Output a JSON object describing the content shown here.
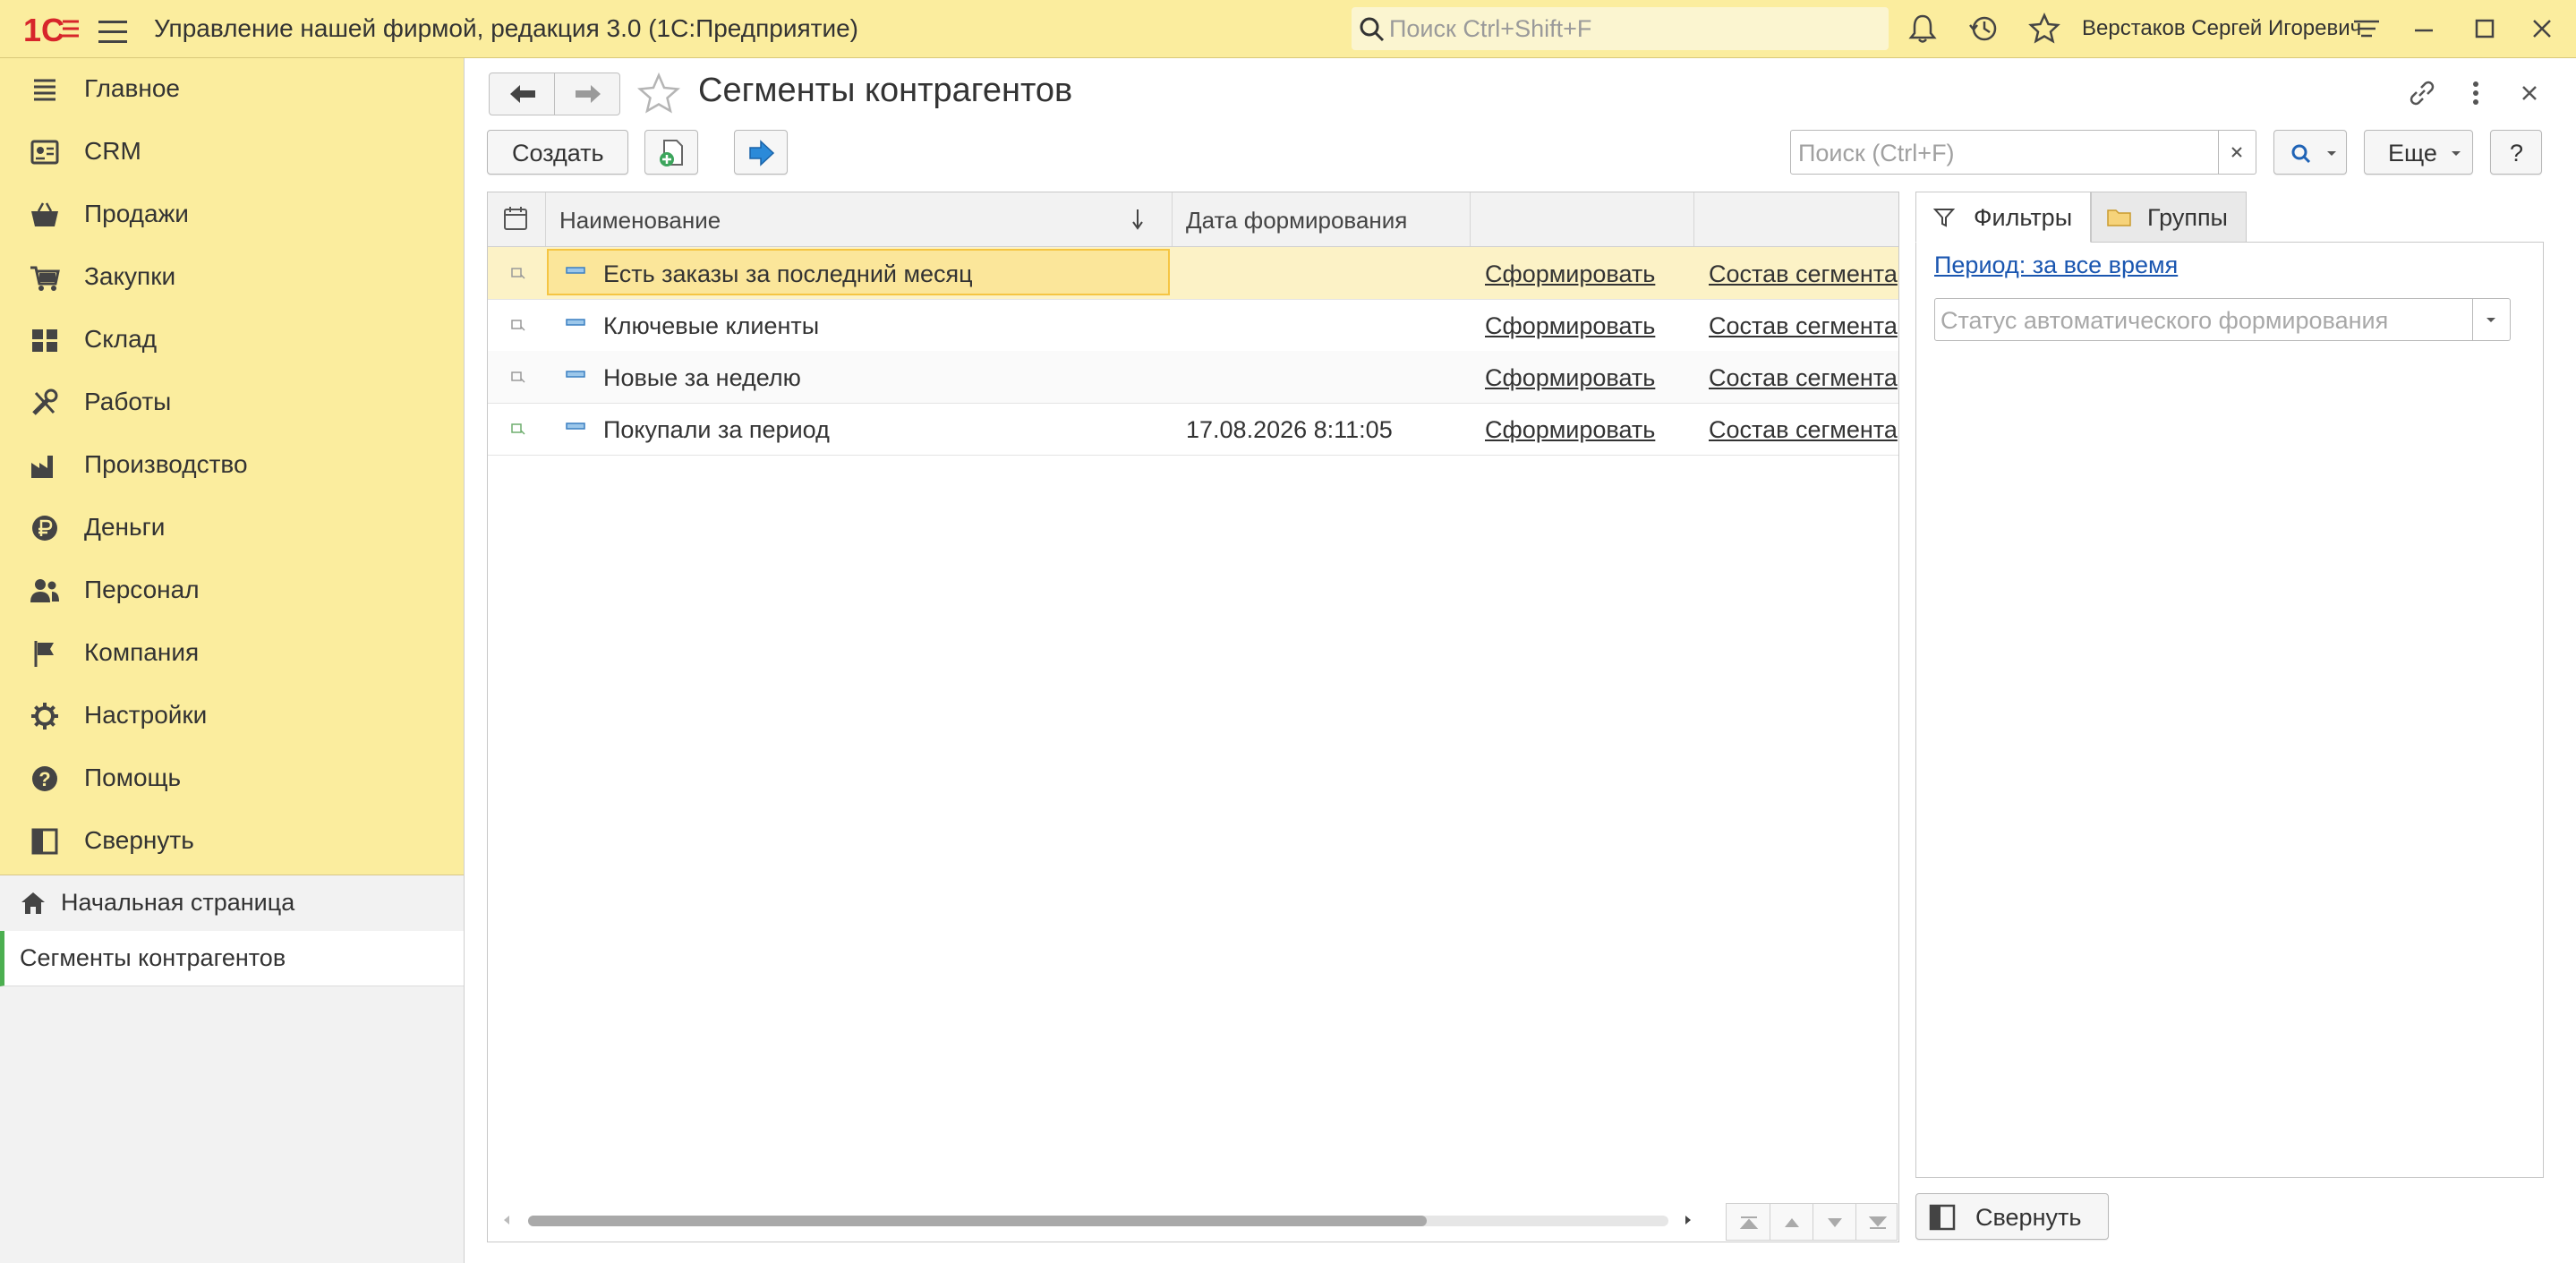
{
  "app": {
    "title": "Управление нашей фирмой, редакция 3.0  (1С:Предприятие)",
    "search_placeholder": "Поиск Ctrl+Shift+F",
    "user": "Верстаков Сергей Игоревич"
  },
  "sections": [
    {
      "label": "Главное",
      "icon": "list-icon"
    },
    {
      "label": "CRM",
      "icon": "crm-icon"
    },
    {
      "label": "Продажи",
      "icon": "basket-icon"
    },
    {
      "label": "Закупки",
      "icon": "cart-icon"
    },
    {
      "label": "Склад",
      "icon": "warehouse-icon"
    },
    {
      "label": "Работы",
      "icon": "tools-icon"
    },
    {
      "label": "Производство",
      "icon": "factory-icon"
    },
    {
      "label": "Деньги",
      "icon": "ruble-icon"
    },
    {
      "label": "Персонал",
      "icon": "people-icon"
    },
    {
      "label": "Компания",
      "icon": "flag-icon"
    },
    {
      "label": "Настройки",
      "icon": "gear-icon"
    },
    {
      "label": "Помощь",
      "icon": "help-icon"
    },
    {
      "label": "Свернуть",
      "icon": "collapse-icon"
    }
  ],
  "open_windows": [
    {
      "label": "Начальная страница",
      "active": false
    },
    {
      "label": "Сегменты контрагентов",
      "active": true
    }
  ],
  "form": {
    "title": "Сегменты контрагентов",
    "create_label": "Создать",
    "search_placeholder": "Поиск (Ctrl+F)",
    "more_label": "Еще",
    "help_label": "?"
  },
  "table": {
    "columns": [
      "Наименование",
      "Дата формирования",
      "",
      ""
    ],
    "rows": [
      {
        "name": "Есть заказы за последний месяц",
        "date": "",
        "action": "Сформировать",
        "link": "Состав сегмента"
      },
      {
        "name": "Ключевые клиенты",
        "date": "",
        "action": "Сформировать",
        "link": "Состав сегмента"
      },
      {
        "name": "Новые за неделю",
        "date": "",
        "action": "Сформировать",
        "link": "Состав сегмента"
      },
      {
        "name": "Покупали за период",
        "date": "17.08.2026 8:11:05",
        "action": "Сформировать",
        "link": "Состав сегмента"
      }
    ]
  },
  "filters": {
    "tab_filters": "Фильтры",
    "tab_groups": "Группы",
    "period_link": "Период: за все время",
    "status_placeholder": "Статус автоматического формирования",
    "collapse_label": "Свернуть"
  },
  "colors": {
    "titlebar": "#fbed9e",
    "selected_row": "#fcf2c6",
    "selected_border": "#f5c543",
    "active_marker": "#4caf50",
    "link": "#1a56b0"
  }
}
